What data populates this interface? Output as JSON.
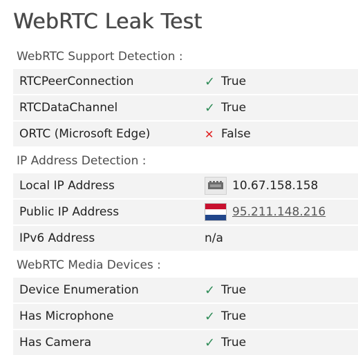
{
  "title": "WebRTC Leak Test",
  "sections": [
    {
      "heading": "WebRTC Support Detection :",
      "rows": [
        {
          "label": "RTCPeerConnection",
          "status": "check",
          "value": "True"
        },
        {
          "label": "RTCDataChannel",
          "status": "check",
          "value": "True"
        },
        {
          "label": "ORTC (Microsoft Edge)",
          "status": "cross",
          "value": "False"
        }
      ]
    },
    {
      "heading": "IP Address Detection :",
      "rows": [
        {
          "label": "Local IP Address",
          "icon": "network-card-icon",
          "value": "10.67.158.158"
        },
        {
          "label": "Public IP Address",
          "icon": "netherlands-flag-icon",
          "value": "95.211.148.216"
        },
        {
          "label": "IPv6 Address",
          "value": "n/a"
        }
      ]
    },
    {
      "heading": "WebRTC Media Devices :",
      "rows": [
        {
          "label": "Device Enumeration",
          "status": "check",
          "value": "True"
        },
        {
          "label": "Has Microphone",
          "status": "check",
          "value": "True"
        },
        {
          "label": "Has Camera",
          "status": "check",
          "value": "True"
        }
      ]
    }
  ],
  "glyphs": {
    "check": "✓",
    "cross": "✕"
  },
  "colors": {
    "check": "#2e8b57",
    "cross": "#e02020",
    "flag_red": "#c8102e",
    "flag_white": "#ffffff",
    "flag_blue": "#21468b"
  }
}
